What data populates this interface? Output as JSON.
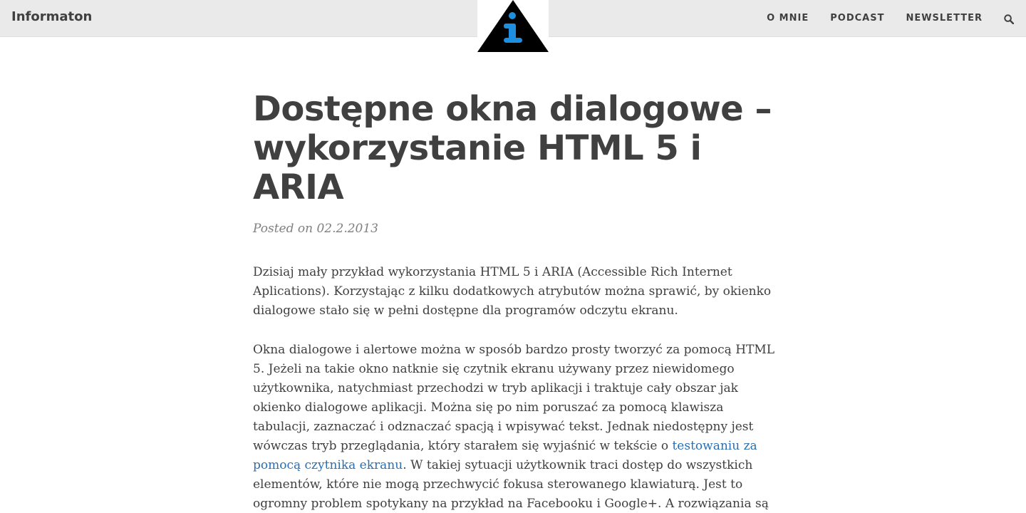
{
  "header": {
    "brand": "Informaton",
    "nav": [
      "O MNIE",
      "PODCAST",
      "NEWSLETTER"
    ],
    "search_icon": "search-icon",
    "logo_icon": "info-triangle-logo-icon",
    "colors": {
      "navbar_bg": "#eaeaea",
      "logo_blue": "#1e8fe0",
      "logo_black": "#000000"
    }
  },
  "post": {
    "title": "Dostępne okna dialogowe – wykorzystanie HTML 5 i ARIA",
    "meta": "Posted on 02.2.2013",
    "p1": "Dzisiaj mały przykład wykorzystania HTML 5 i ARIA (Accessible Rich Internet Aplications). Korzystając z kilku dodatkowych atrybutów można sprawić, by okienko dialogowe stało się w pełni dostępne dla programów odczytu ekranu.",
    "p2_before": "Okna dialogowe i alertowe można w sposób bardzo prosty tworzyć za pomocą HTML 5. Jeżeli na takie okno natknie się czytnik ekranu używany przez niewidomego użytkownika, natychmiast przechodzi w tryb aplikacji i traktuje cały obszar jak okienko dialogowe aplikacji. Można się po nim poruszać za pomocą klawisza tabulacji, zaznaczać i odznaczać spacją i wpisywać tekst. Jednak niedostępny jest wówczas tryb przeglądania, który starałem się wyjaśnić w tekście o ",
    "p2_link": "testowaniu za pomocą czytnika ekranu",
    "p2_after": ". W takiej sytuacji użytkownik traci dostęp do wszystkich elementów, które nie mogą przechwycić fokusa sterowanego klawiaturą. Jest to ogromny problem spotykany na przykład na Facebooku i Google+. A rozwiązania są dostępne i wystarczy z nich",
    "link_color": "#2a6fb3"
  }
}
